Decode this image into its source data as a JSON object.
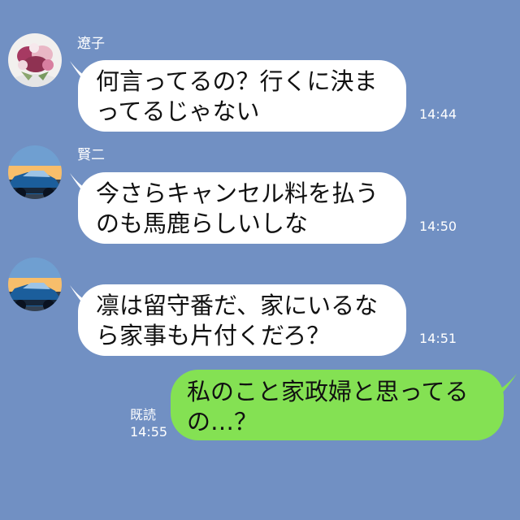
{
  "messages": [
    {
      "sender": "遼子",
      "avatar": "bouquet-avatar",
      "lines": [
        "何言ってるの？行くに決ま",
        "ってるじゃない"
      ],
      "time": "14:44",
      "direction": "incoming"
    },
    {
      "sender": "賢二",
      "avatar": "car-avatar",
      "lines": [
        "今さらキャンセル料を払う",
        "のも馬鹿らしいしな"
      ],
      "time": "14:50",
      "direction": "incoming"
    },
    {
      "sender": "",
      "avatar": "car-avatar",
      "lines": [
        "凛は留守番だ、家にいるな",
        "ら家事も片付くだろ？"
      ],
      "time": "14:51",
      "direction": "incoming"
    },
    {
      "sender": "",
      "lines": [
        "私のこと家政婦と思ってる",
        "の…？"
      ],
      "time": "14:55",
      "status": "既読",
      "direction": "outgoing"
    }
  ],
  "colors": {
    "background": "#7190c3",
    "incoming_bubble": "#ffffff",
    "outgoing_bubble": "#84e153",
    "meta_text": "#ffffff"
  }
}
